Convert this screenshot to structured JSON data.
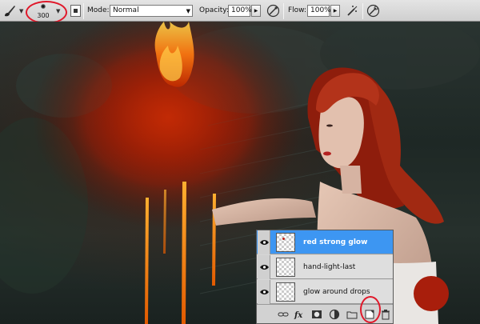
{
  "options_bar": {
    "brush_tool_icon": "brush-icon",
    "brush_size": "300",
    "mode_label": "Mode:",
    "mode_value": "Normal",
    "opacity_label": "Opacity:",
    "opacity_value": "100%",
    "flow_label": "Flow:",
    "flow_value": "100%"
  },
  "layers_panel": {
    "layers": [
      {
        "name": "red strong glow",
        "selected": true
      },
      {
        "name": "hand-light-last",
        "selected": false
      },
      {
        "name": "glow around drops",
        "selected": false
      }
    ],
    "footer_icons": [
      "link-icon",
      "fx-icon",
      "mask-icon",
      "adjustment-icon",
      "group-icon",
      "new-layer-icon",
      "trash-icon"
    ]
  },
  "colors": {
    "selected_layer": "#3d96f2",
    "annotation": "#e0182a",
    "swatch": "#a81e0c"
  }
}
